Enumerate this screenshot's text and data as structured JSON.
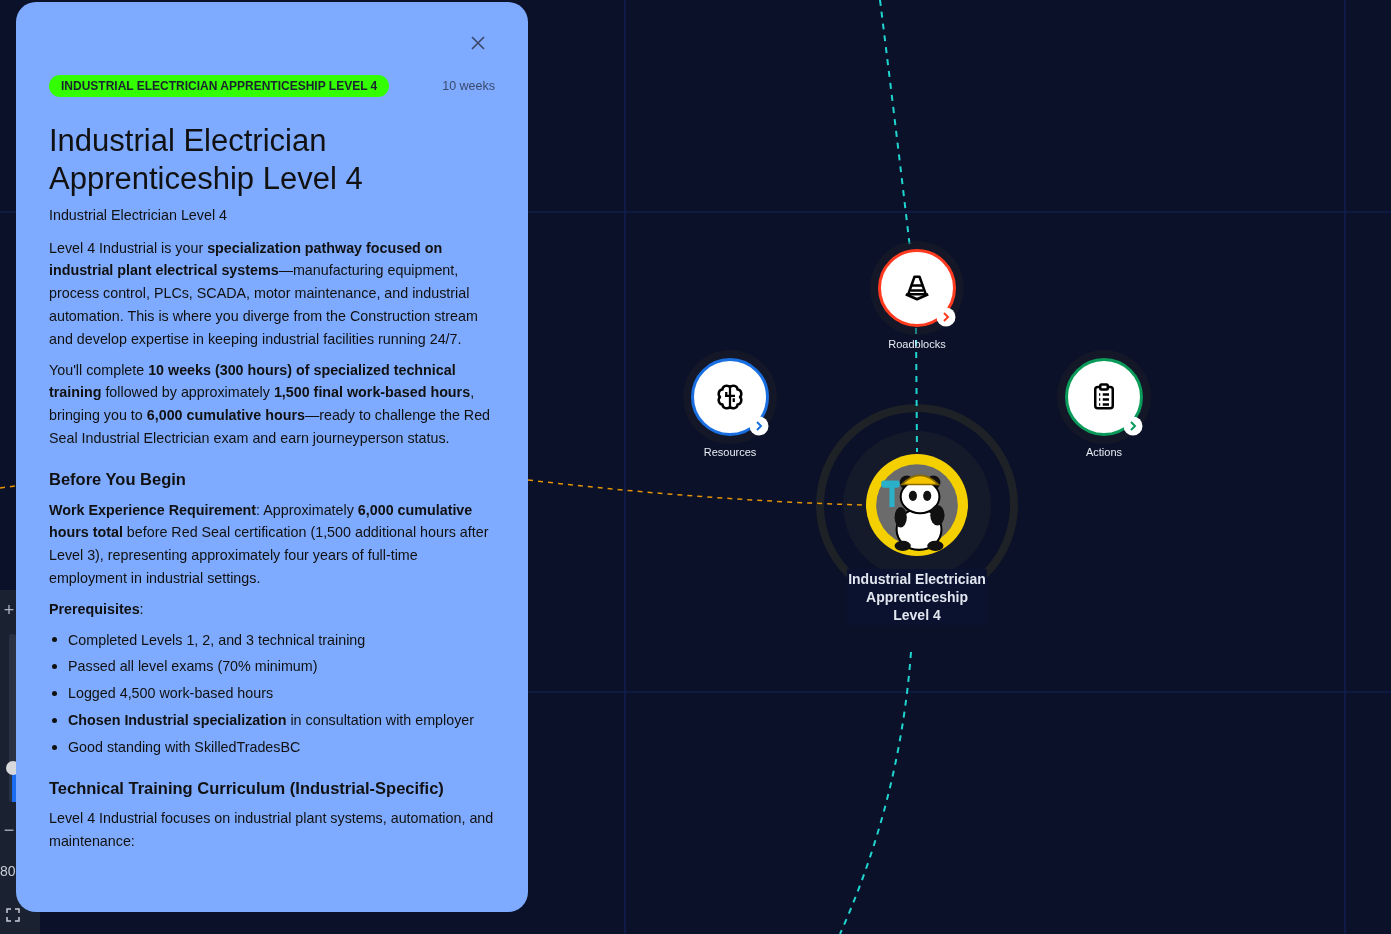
{
  "detail_panel": {
    "badge": "INDUSTRIAL ELECTRICIAN APPRENTICESHIP LEVEL 4",
    "duration": "10 weeks",
    "title": "Industrial Electrician Apprenticeship Level 4",
    "subtitle": "Industrial Electrician Level 4",
    "sections": [
      {
        "kind": "paragraph",
        "text": "Level 4 Industrial is your **specialization pathway focused on industrial plant electrical systems**—manufacturing equipment, process control, PLCs, SCADA, motor maintenance, and industrial automation. This is where you diverge from the Construction stream and develop expertise in keeping industrial facilities running 24/7."
      },
      {
        "kind": "paragraph",
        "text": "You'll complete **10 weeks (300 hours) of specialized technical training** followed by approximately **1,500 final work-based hours**, bringing you to **6,000 cumulative hours**—ready to challenge the Red Seal Industrial Electrician exam and earn journeyperson status."
      },
      {
        "kind": "heading",
        "text": "Before You Begin"
      },
      {
        "kind": "paragraph",
        "text": "**Work Experience Requirement**: Approximately **6,000 cumulative hours total** before Red Seal certification (1,500 additional hours after Level 3), representing approximately four years of full-time employment in industrial settings."
      },
      {
        "kind": "paragraph",
        "text": "**Prerequisites**:"
      },
      {
        "kind": "list",
        "items": [
          "Completed Levels 1, 2, and 3 technical training",
          "Passed all level exams (70% minimum)",
          "Logged 4,500 work-based hours",
          "**Chosen Industrial specialization** in consultation with employer",
          "Good standing with SkilledTradesBC"
        ]
      },
      {
        "kind": "heading",
        "text": "Technical Training Curriculum (Industrial-Specific)"
      },
      {
        "kind": "paragraph",
        "text": "Level 4 Industrial focuses on industrial plant systems, automation, and maintenance:"
      }
    ]
  },
  "map": {
    "nodes": [
      {
        "label": "Roadblocks",
        "kind": "cone",
        "color": "#ff3b1f"
      },
      {
        "label": "Resources",
        "kind": "brain",
        "color": "#1a6fe0"
      },
      {
        "label": "Actions",
        "kind": "clipboard",
        "color": "#0a9a5a"
      }
    ],
    "center": {
      "label": "Industrial Electrician Apprenticeship Level 4"
    }
  },
  "zoom_controls": {
    "plus": "+",
    "minus": "−",
    "level": 0.2,
    "reading": "80"
  }
}
